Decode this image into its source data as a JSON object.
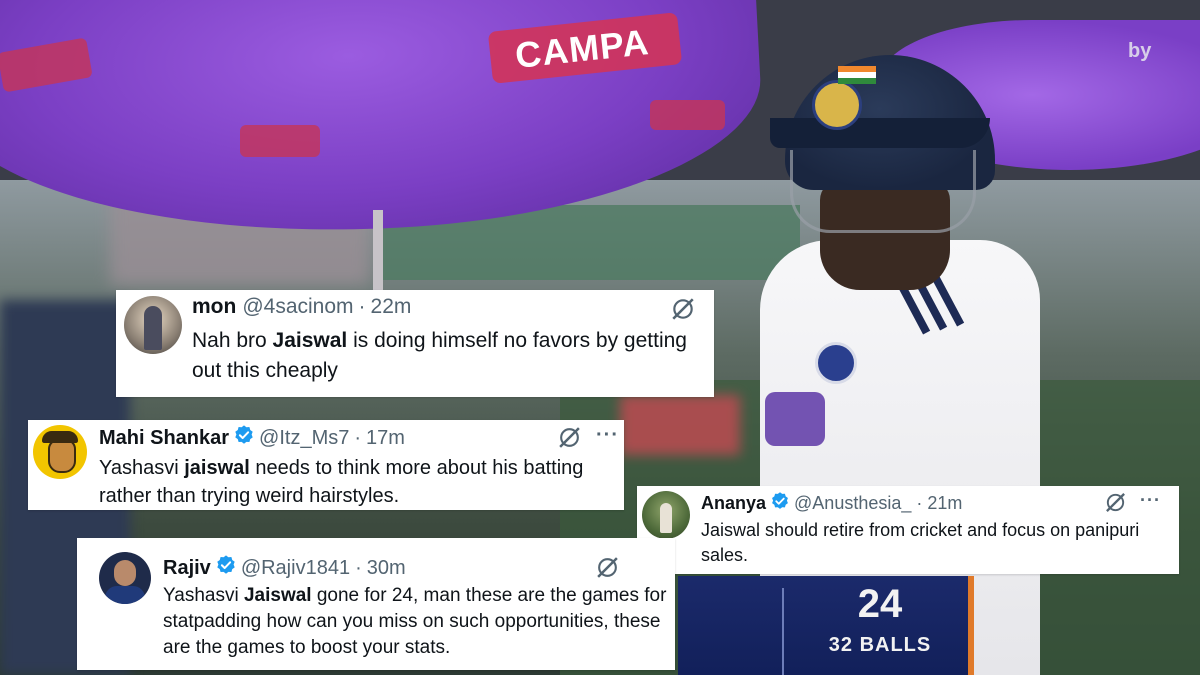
{
  "background": {
    "umbrella_brand": "CAMPA",
    "watermark": "by",
    "score": {
      "runs": "24",
      "balls": "32 BALLS"
    },
    "colors": {
      "umbrella": "#7b3fc4",
      "shirt": "#f4f4f6",
      "helmet": "#1c2a44",
      "score_panel": "#15235f"
    }
  },
  "tweets": [
    {
      "name": "mon",
      "handle": "@4sacinom",
      "time": "22m",
      "verified": false,
      "text_parts": [
        "Nah bro ",
        "Jaiswal",
        " is doing himself no favors by getting out this cheaply"
      ],
      "icons": [
        "grok-icon"
      ]
    },
    {
      "name": "Mahi Shankar",
      "handle": "@Itz_Ms7",
      "time": "17m",
      "verified": true,
      "text_parts": [
        "Yashasvi ",
        "jaiswal",
        " needs to think more about his batting rather than trying weird hairstyles."
      ],
      "icons": [
        "grok-icon",
        "more-icon"
      ],
      "more": "···"
    },
    {
      "name": "Ananya",
      "handle": "@Anusthesia_",
      "time": "21m",
      "verified": true,
      "text_parts": [
        "Jaiswal should retire from cricket and focus on panipuri sales."
      ],
      "icons": [
        "grok-icon",
        "more-icon"
      ],
      "more": "···"
    },
    {
      "name": "Rajiv",
      "handle": "@Rajiv1841",
      "time": "30m",
      "verified": true,
      "text_parts": [
        "Yashasvi ",
        "Jaiswal",
        " gone for 24, man these are the games for statpadding how can you miss on such opportunities, these are the games to boost your stats."
      ],
      "icons": [
        "grok-icon"
      ]
    }
  ],
  "theme": {
    "verified": "#1d9bf0",
    "muted": "#536471",
    "text": "#0f1419"
  }
}
